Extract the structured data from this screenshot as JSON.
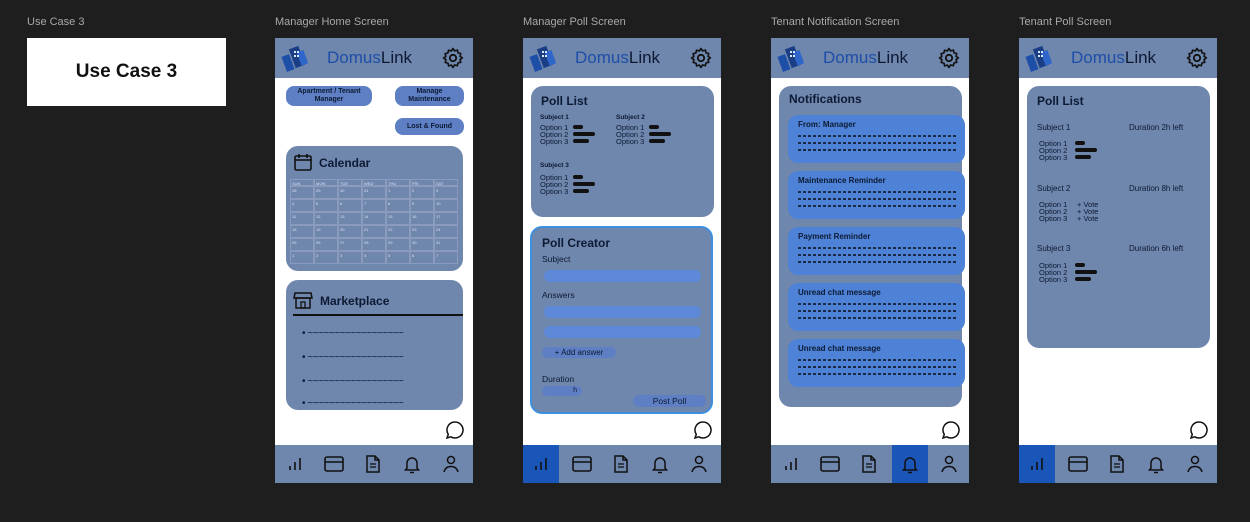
{
  "frame_labels": [
    "Use Case 3",
    "Manager Home Screen",
    "Manager Poll Screen",
    "Tenant Notification Screen",
    "Tenant Poll Screen"
  ],
  "use_case_title": "Use Case 3",
  "app": {
    "brand_a": "Domus",
    "brand_b": "Link"
  },
  "colors": {
    "card": "#6f86ad",
    "accent": "#1a56b7",
    "pill": "#5e7fc4",
    "brand": "#1d4ea8"
  },
  "manager_home": {
    "btn_apartment": "Apartment / Tenant Manager",
    "btn_maintenance": "Manage Maintenance",
    "btn_lost": "Lost & Found",
    "calendar_title": "Calendar",
    "calendar_days": [
      "SUN",
      "MON",
      "TUE",
      "WED",
      "THU",
      "FRI",
      "SAT"
    ],
    "calendar_numbers": [
      "28",
      "29",
      "30",
      "31",
      "1",
      "2",
      "3",
      "4",
      "5",
      "6",
      "7",
      "8",
      "9",
      "10",
      "11",
      "12",
      "13",
      "14",
      "15",
      "16",
      "17",
      "18",
      "19",
      "20",
      "21",
      "22",
      "23",
      "24",
      "25",
      "26",
      "27",
      "28",
      "29",
      "30",
      "31",
      "1",
      "2",
      "3",
      "4",
      "5",
      "6",
      "7"
    ],
    "marketplace_title": "Marketplace",
    "marketplace_items": [
      "~~~~~~~~~~~~~~~~~~",
      "~~~~~~~~~~~~~~~~~~",
      "~~~~~~~~~~~~~~~~~~",
      "~~~~~~~~~~~~~~~~~~"
    ]
  },
  "manager_poll": {
    "poll_list_title": "Poll List",
    "subject1": "Subject 1",
    "subject2": "Subject 2",
    "subject3": "Subject 3",
    "option1": "Option 1",
    "option2": "Option 2",
    "option3": "Option 3",
    "creator_title": "Poll Creator",
    "subject_label": "Subject",
    "answers_label": "Answers",
    "add_answer": "+   Add answer",
    "duration_label": "Duration",
    "duration_unit": "h",
    "post_poll": "Post Poll"
  },
  "tenant_notifications": {
    "title": "Notifications",
    "items": [
      "From: Manager",
      "Maintenance Reminder",
      "Payment Reminder",
      "Unread chat message",
      "Unread chat message"
    ]
  },
  "tenant_poll": {
    "title": "Poll List",
    "polls": [
      {
        "subject": "Subject 1",
        "duration": "Duration  2h left"
      },
      {
        "subject": "Subject 2",
        "duration": "Duration  8h left"
      },
      {
        "subject": "Subject 3",
        "duration": "Duration  6h left"
      }
    ],
    "option1": "Option 1",
    "option2": "Option 2",
    "option3": "Option 3",
    "vote": "+ Vote"
  },
  "nav_icons": [
    "stats-icon",
    "card-icon",
    "document-icon",
    "bell-icon",
    "profile-icon"
  ]
}
